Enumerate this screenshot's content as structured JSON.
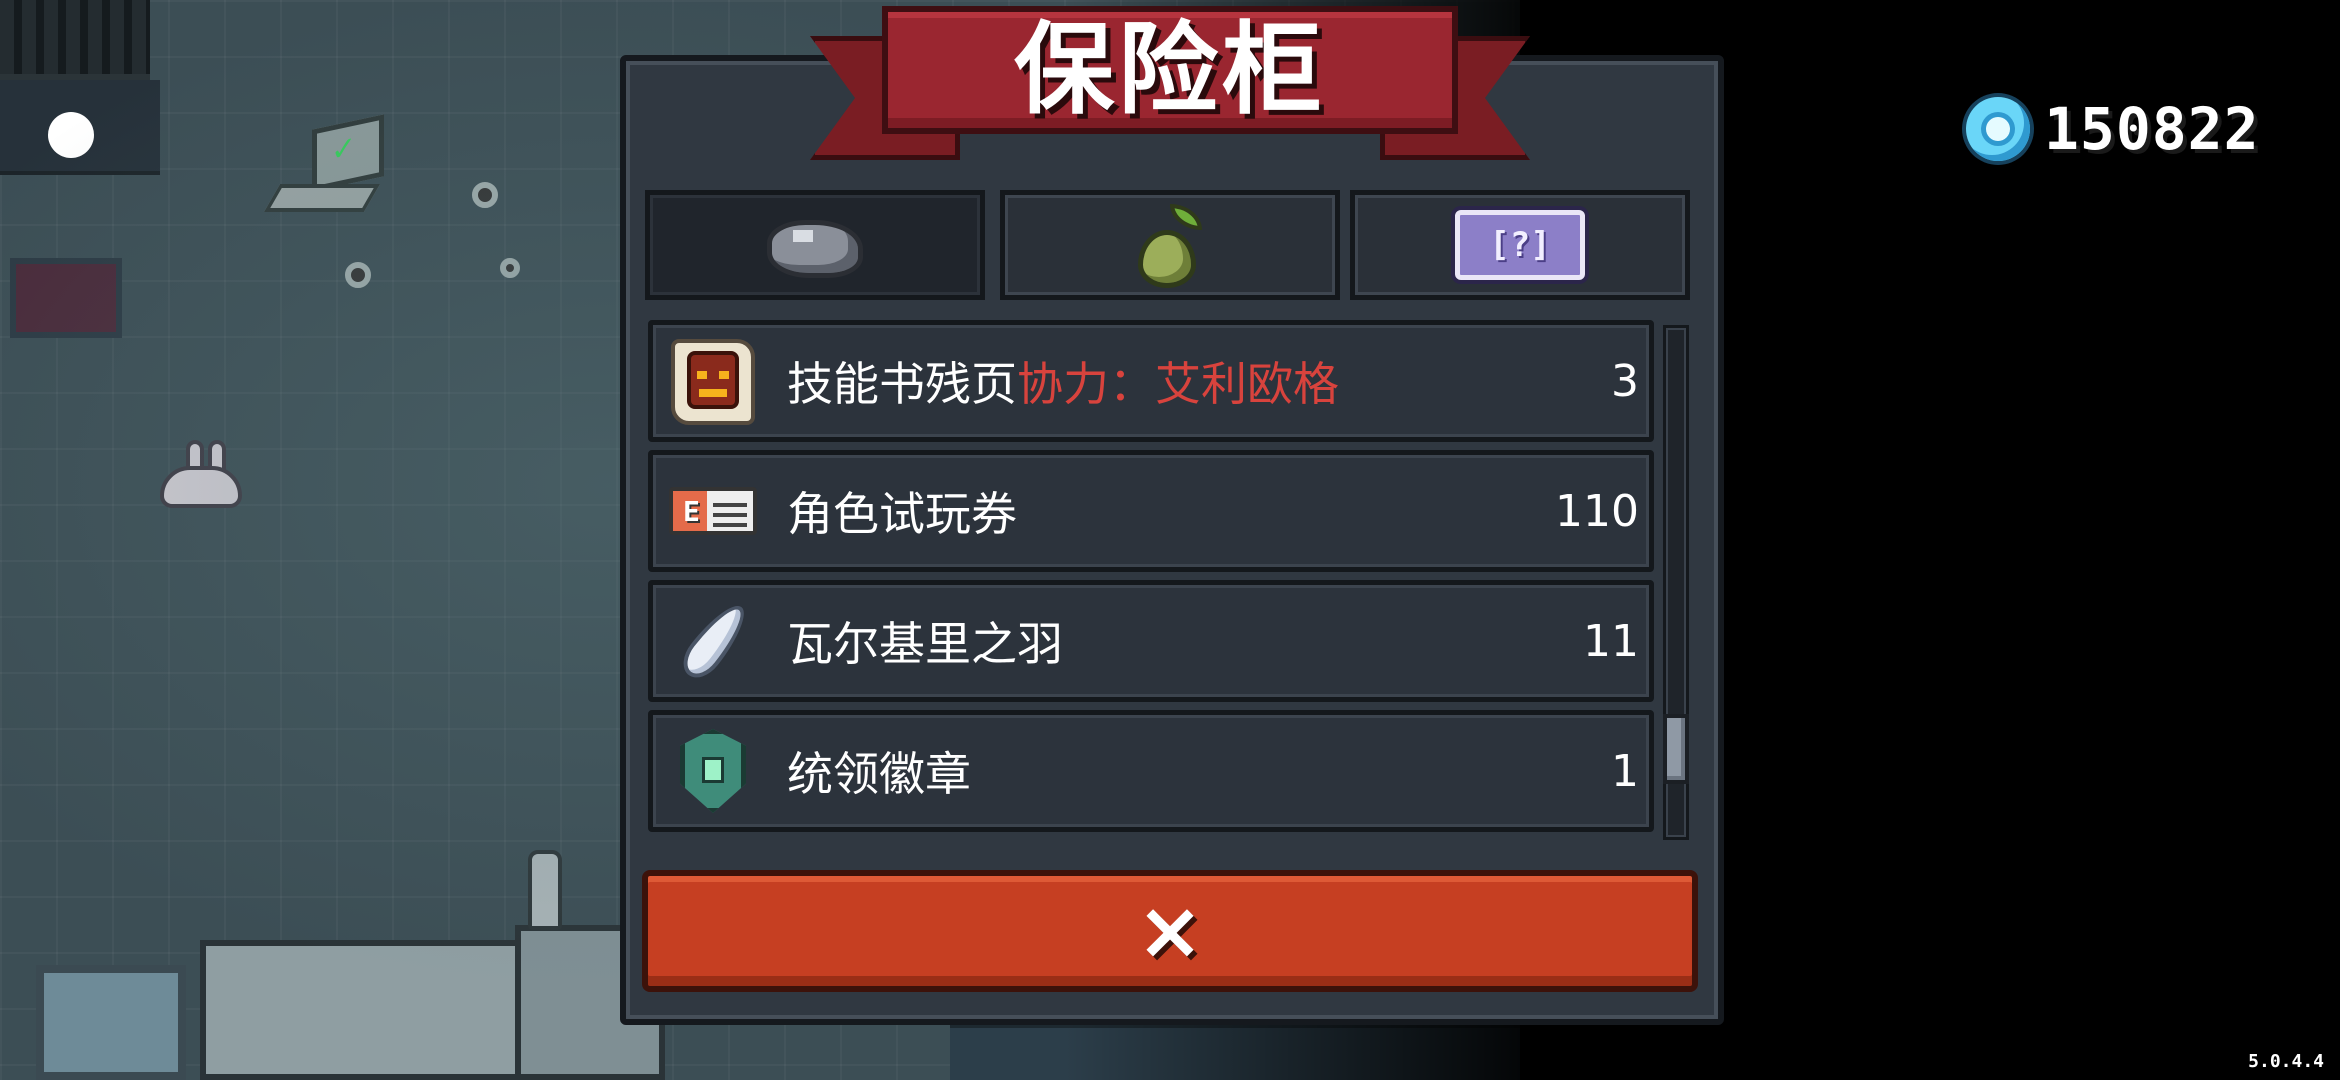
{
  "panel": {
    "title": "保险柜",
    "tabs": [
      {
        "icon": "ore-icon",
        "active": true
      },
      {
        "icon": "seed-icon",
        "active": false
      },
      {
        "icon": "mystery-ticket-icon",
        "active": false,
        "text": "[?]"
      }
    ],
    "items": [
      {
        "icon": "skill-book-page-icon",
        "label": "技能书残页",
        "label_accent": "协力：艾利欧格",
        "count": "3"
      },
      {
        "icon": "character-trial-card-icon",
        "label": "角色试玩券",
        "count": "110"
      },
      {
        "icon": "feather-icon",
        "label": "瓦尔基里之羽",
        "count": "11"
      },
      {
        "icon": "commander-badge-icon",
        "label": "统领徽章",
        "count": "1"
      }
    ],
    "close_icon": "×"
  },
  "currency": {
    "icon": "gem-icon",
    "amount": "150822"
  },
  "version": "5.0.4.4",
  "colors": {
    "banner": "#9a2630",
    "close_button": "#c63f22",
    "accent_text": "#d8433d",
    "panel_bg": "#303841"
  }
}
